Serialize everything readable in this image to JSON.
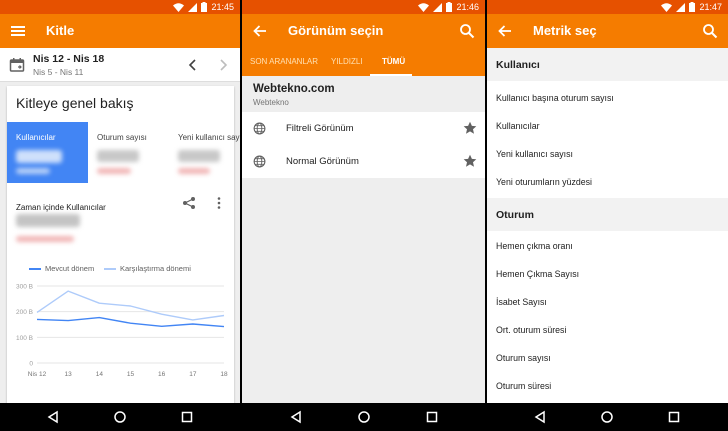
{
  "colors": {
    "status_bar": "#e65100",
    "app_bar": "#f57c00",
    "selected_metric": "#4285f4",
    "current_series": "#4285f4",
    "comparison_series": "#aecbfa"
  },
  "screen1": {
    "status": {
      "time": "21:45"
    },
    "appbar": {
      "title": "Kitle",
      "nav_icon": "menu-icon"
    },
    "date_range": {
      "primary": "Nis 12 - Nis 18",
      "compare": "Nis 5 - Nis 11"
    },
    "card_title": "Kitleye genel bakış",
    "metrics": [
      {
        "label": "Kullanıcılar",
        "selected": true
      },
      {
        "label": "Oturum sayısı",
        "selected": false
      },
      {
        "label": "Yeni kullanıcı sayı",
        "selected": false
      }
    ],
    "chart_section_title": "Zaman içinde Kullanıcılar",
    "legend": {
      "current": "Mevcut dönem",
      "comparison": "Karşılaştırma dönemi"
    },
    "chart_data": {
      "type": "line",
      "categories": [
        "Nis 12",
        "13",
        "14",
        "15",
        "16",
        "17",
        "18"
      ],
      "series": [
        {
          "name": "Mevcut dönem",
          "values": [
            170,
            165,
            177,
            155,
            143,
            152,
            142
          ]
        },
        {
          "name": "Karşılaştırma dönemi",
          "values": [
            197,
            280,
            233,
            222,
            190,
            168,
            185
          ]
        }
      ],
      "yticks": [
        0,
        100,
        200,
        300
      ],
      "ytick_labels": [
        "0",
        "100 B",
        "200 B",
        "300 B"
      ],
      "ylim": [
        0,
        300
      ],
      "grid": true
    }
  },
  "screen2": {
    "status": {
      "time": "21:46"
    },
    "appbar": {
      "title": "Görünüm seçin",
      "nav_icon": "back-arrow-icon",
      "action_icon": "search-icon"
    },
    "tabs": [
      {
        "label": "SON ARANANLAR",
        "active": false
      },
      {
        "label": "YILDIZLI",
        "active": false
      },
      {
        "label": "TÜMÜ",
        "active": true
      }
    ],
    "account": {
      "name": "Webtekno.com",
      "property": "Webtekno"
    },
    "views": [
      {
        "label": "Filtreli Görünüm",
        "icon": "globe-icon",
        "starred": true
      },
      {
        "label": "Normal Görünüm",
        "icon": "globe-icon",
        "starred": true
      }
    ]
  },
  "screen3": {
    "status": {
      "time": "21:47"
    },
    "appbar": {
      "title": "Metrik seç",
      "nav_icon": "back-arrow-icon",
      "action_icon": "search-icon"
    },
    "sections": [
      {
        "title": "Kullanıcı",
        "items": [
          "Kullanıcı başına oturum sayısı",
          "Kullanıcılar",
          "Yeni kullanıcı sayısı",
          "Yeni oturumların yüzdesi"
        ]
      },
      {
        "title": "Oturum",
        "items": [
          "Hemen çıkma oranı",
          "Hemen Çıkma Sayısı",
          "İsabet Sayısı",
          "Ort. oturum süresi",
          "Oturum sayısı",
          "Oturum süresi"
        ]
      }
    ]
  }
}
